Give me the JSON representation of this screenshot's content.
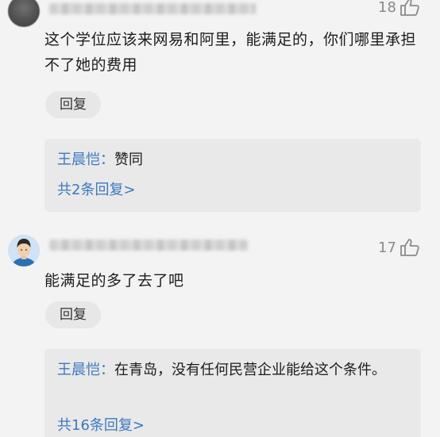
{
  "comments": [
    {
      "likes": "18",
      "text": "这个学位应该来网易和阿里，能满足的，你们哪里承担不了她的费用",
      "reply_label": "回复",
      "reply_preview": {
        "user": "王晨恺：",
        "text": "赞同",
        "more_label": "共2条回复>"
      }
    },
    {
      "likes": "17",
      "text": "能满足的多了去了吧",
      "reply_label": "回复",
      "reply_preview": {
        "user": "王晨恺：",
        "text": "在青岛，没有任何民营企业能给这个条件。",
        "more_label": "共16条回复>"
      }
    }
  ],
  "icons": {
    "like": "thumbs-up-icon"
  },
  "colors": {
    "background": "#f3f3f3",
    "link_blue": "#3a78c2",
    "reply_box": "#e9e9e9",
    "reply_button": "#e7e7e7",
    "text": "#1c1c1c",
    "muted": "#8a8a8a"
  }
}
